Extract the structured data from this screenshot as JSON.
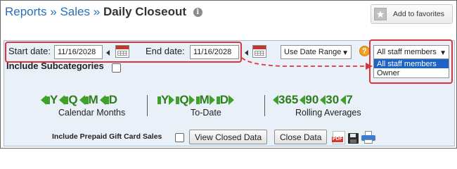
{
  "header": {
    "crumb_reports": "Reports",
    "sep1": "»",
    "crumb_sales": "Sales",
    "sep2": "»",
    "title": "Daily Closeout",
    "info_icon": "i",
    "favorites_label": "Add to favorites",
    "favorites_icon": "star-icon"
  },
  "filters": {
    "start_label": "Start date:",
    "start_value": "11/16/2028",
    "end_label": "End date:",
    "end_value": "11/16/2028",
    "range_select": "Use Date Range",
    "help_icon": "?",
    "staff_select": "All staff members",
    "staff_options": [
      "All staff members",
      "Owner"
    ],
    "include_subcategories": "Include Subcategories",
    "include_subcategories_checked": false
  },
  "shortcuts": {
    "calendar_months": {
      "label": "Calendar Months",
      "items": [
        "Y",
        "Q",
        "M",
        "D"
      ]
    },
    "to_date": {
      "label": "To-Date",
      "items": [
        "Y",
        "Q",
        "M",
        "D"
      ]
    },
    "rolling": {
      "label": "Rolling Averages",
      "items": [
        "365",
        "90",
        "30",
        "7"
      ]
    }
  },
  "footer": {
    "prepaid_label": "Include Prepaid Gift Card Sales",
    "prepaid_checked": false,
    "view_closed": "View Closed Data",
    "close_data": "Close Data",
    "pdf_icon_text": "PDF",
    "icons": [
      "pdf-icon",
      "save-icon",
      "print-icon"
    ]
  },
  "colors": {
    "link": "#2a6ebb",
    "highlight": "#d9363e",
    "panel": "#e9f0f8",
    "shortcut_green": "#3fa12a",
    "selected": "#1e63c6"
  }
}
